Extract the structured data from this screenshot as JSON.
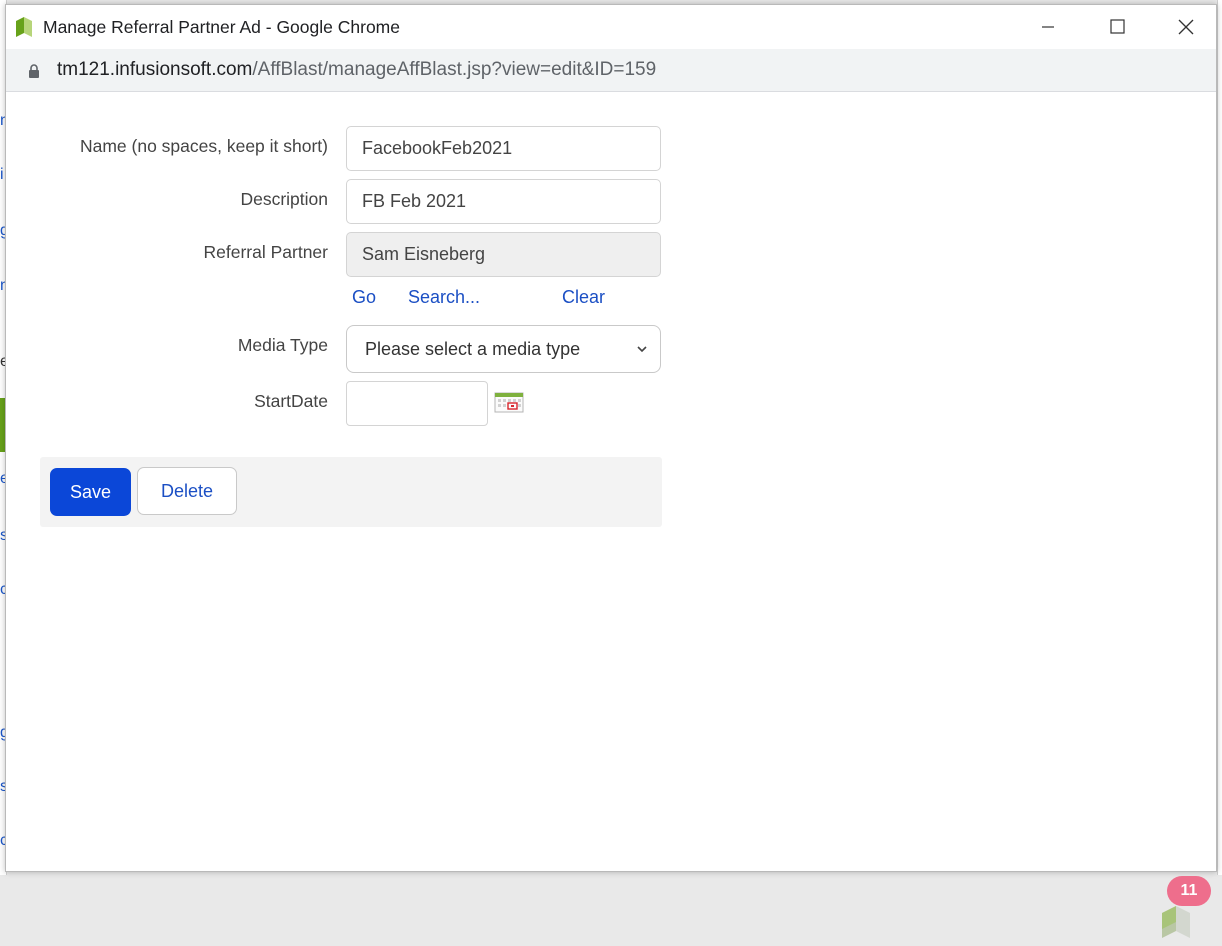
{
  "window": {
    "title": "Manage Referral Partner Ad - Google Chrome",
    "url_host": "tm121.infusionsoft.com",
    "url_path": "/AffBlast/manageAffBlast.jsp?view=edit&ID=159"
  },
  "form": {
    "name_label": "Name (no spaces, keep it short)",
    "name_value": "FacebookFeb2021",
    "description_label": "Description",
    "description_value": "FB Feb 2021",
    "partner_label": "Referral Partner",
    "partner_value": "Sam Eisneberg",
    "partner_links": {
      "go": "Go",
      "search": "Search...",
      "clear": "Clear"
    },
    "media_type_label": "Media Type",
    "media_type_selected": "Please select a media type",
    "start_date_label": "StartDate",
    "start_date_value": ""
  },
  "actions": {
    "save": "Save",
    "delete": "Delete"
  },
  "notification_badge": "11",
  "background_fragments": [
    "n",
    "i",
    "g",
    "n",
    "e",
    "r",
    "e",
    "s",
    "c",
    "g",
    "s",
    "c"
  ],
  "colors": {
    "primary": "#0b47d8",
    "link": "#1b4fc4",
    "badge": "#ee6e8c",
    "brand_green": "#67a21a"
  }
}
